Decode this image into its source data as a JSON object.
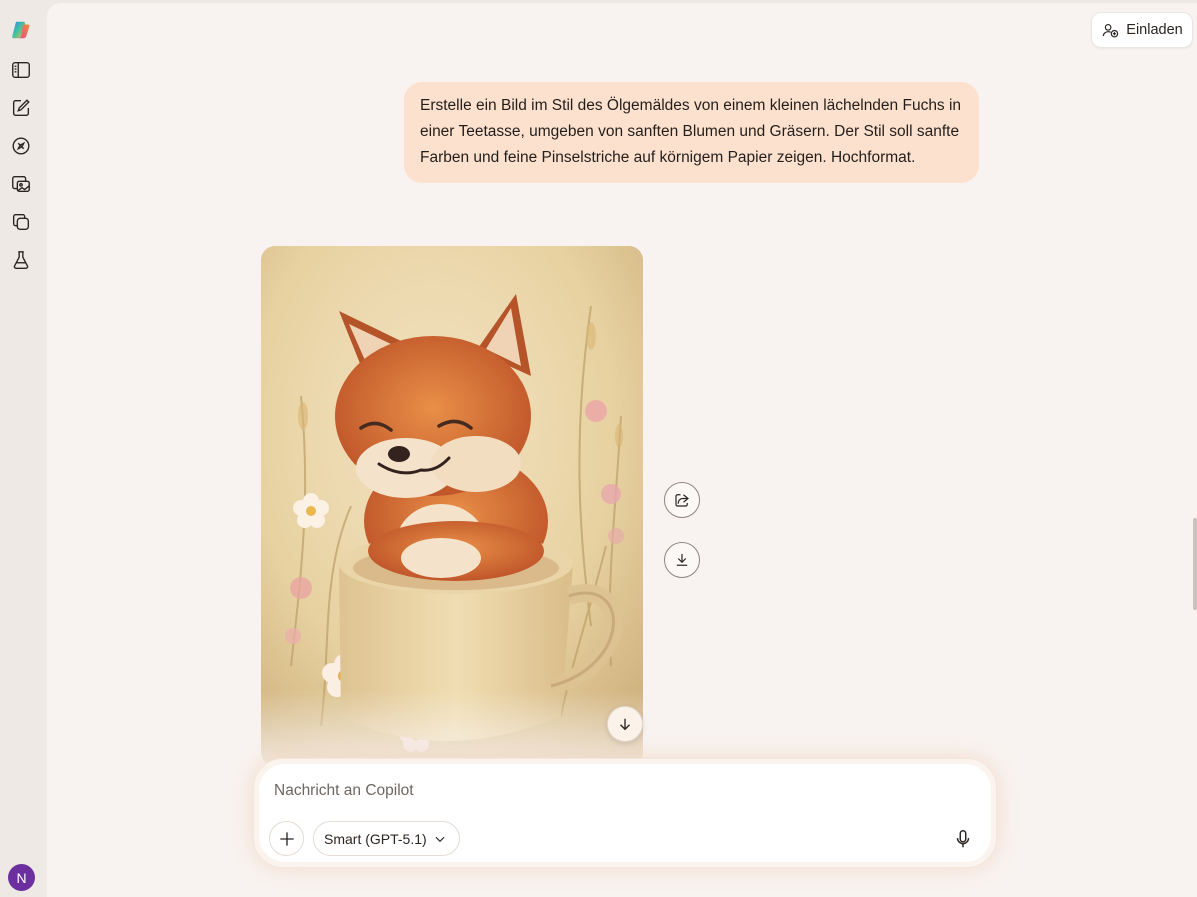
{
  "header": {
    "invite_label": "Einladen"
  },
  "sidebar": {
    "items": [
      {
        "icon": "copilot-logo-icon"
      },
      {
        "icon": "sidebar-toggle-icon"
      },
      {
        "icon": "new-chat-icon"
      },
      {
        "icon": "discover-compass-icon"
      },
      {
        "icon": "image-gallery-icon"
      },
      {
        "icon": "pages-copy-icon"
      },
      {
        "icon": "labs-flask-icon"
      }
    ],
    "avatar_initial": "N"
  },
  "conversation": {
    "user_message": "Erstelle ein Bild im Stil des Ölgemäldes von einem kleinen lächelnden Fuchs in einer Teetasse, umgeben von sanften Blumen und Gräsern. Der Stil soll sanfte Farben und feine Pinselstriche auf körnigem Papier zeigen. Hochformat.",
    "image_actions": [
      "share-icon",
      "download-icon"
    ]
  },
  "composer": {
    "placeholder": "Nachricht an Copilot",
    "model_label": "Smart (GPT-5.1)"
  },
  "colors": {
    "user_bubble": "#fce1cf",
    "main_bg": "#f8f3f0",
    "sidebar_bg": "#efe9e5",
    "avatar_bg": "#6b2fa0"
  }
}
